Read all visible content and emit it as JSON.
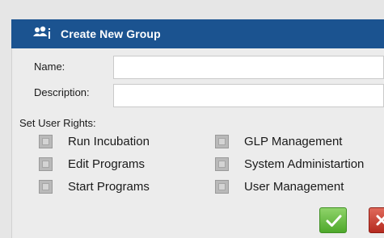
{
  "dialog": {
    "title": "Create New Group",
    "title_icon": "users-icon",
    "header_color": "#1b5390"
  },
  "fields": {
    "name_label": "Name:",
    "name_value": "",
    "description_label": "Description:",
    "description_value": ""
  },
  "rights": {
    "section_label": "Set User Rights:",
    "items": [
      {
        "label": "Run Incubation",
        "checked": false
      },
      {
        "label": "Edit Programs",
        "checked": false
      },
      {
        "label": "Start Programs",
        "checked": false
      },
      {
        "label": "GLP Management",
        "checked": false
      },
      {
        "label": "System Administartion",
        "checked": false
      },
      {
        "label": "User Management",
        "checked": false
      }
    ]
  },
  "buttons": {
    "ok_icon": "checkmark-icon",
    "cancel_icon": "close-icon",
    "ok_color": "#5cb335",
    "cancel_color": "#c9372a"
  }
}
